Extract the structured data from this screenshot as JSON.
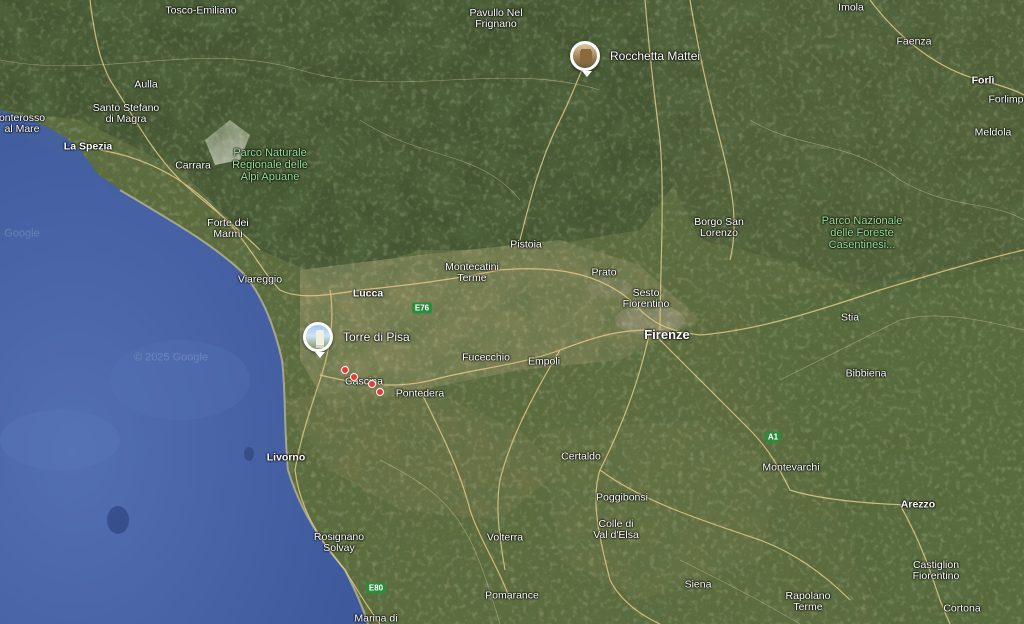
{
  "map": {
    "copyright": "© 2025 Google",
    "google_mark": "Google",
    "colors": {
      "sea": "#4d66a8",
      "land": "#5f6e3e",
      "road": "#e3c98a"
    }
  },
  "poi": {
    "torre": {
      "name": "Torre di Pisa",
      "icon": "tower-icon"
    },
    "rocchetta": {
      "name": "Rocchetta Mattei",
      "icon": "castle-icon"
    }
  },
  "places": {
    "firenze": "Firenze",
    "prato": "Prato",
    "pistoia": "Pistoia",
    "lucca": "Lucca",
    "livorno": "Livorno",
    "arezzo": "Arezzo",
    "la_spezia": "La Spezia",
    "viareggio": "Viareggio",
    "forte_dei_marmi": "Forte dei\nMarmi",
    "carrara": "Carrara",
    "aulla": "Aulla",
    "santo_stefano": "Santo Stefano\ndi Magra",
    "monterosso": "onterosso\nal Mare",
    "montecatini": "Montecatini\nTerme",
    "fucecchio": "Fucecchio",
    "empoli": "Empoli",
    "cascina": "Cascina",
    "pontedera": "Pontedera",
    "certaldo": "Certaldo",
    "poggibonsi": "Poggibonsi",
    "colle": "Colle di\nVal d'Elsa",
    "volterra": "Volterra",
    "rosignano": "Rosignano\nSolvay",
    "pomarance": "Pomarance",
    "marina": "Marina di",
    "siena": "Siena",
    "rapolano": "Rapolano\nTerme",
    "montevarchi": "Montevarchi",
    "castiglion": "Castiglion\nFiorentino",
    "cortona": "Cortona",
    "bibbiena": "Bibbiena",
    "stia": "Stia",
    "borgo": "Borgo San\nLorenzo",
    "sesto": "Sesto\nFiorentino",
    "pavullo": "Pavullo Nel\nFrignano",
    "imola": "Imola",
    "faenza": "Faenza",
    "forli": "Forlì",
    "forlimp": "Forlimp",
    "meldola": "Meldola",
    "tosco": "Tosco-Emiliano"
  },
  "parks": {
    "alpi_apuane": "Parco Naturale Regionale delle Alpi Apuane",
    "casentinesi": "Parco Nazionale delle Foreste Casentinesi..."
  },
  "roads": {
    "e76": "E76",
    "a1": "A1",
    "e80": "E80"
  }
}
